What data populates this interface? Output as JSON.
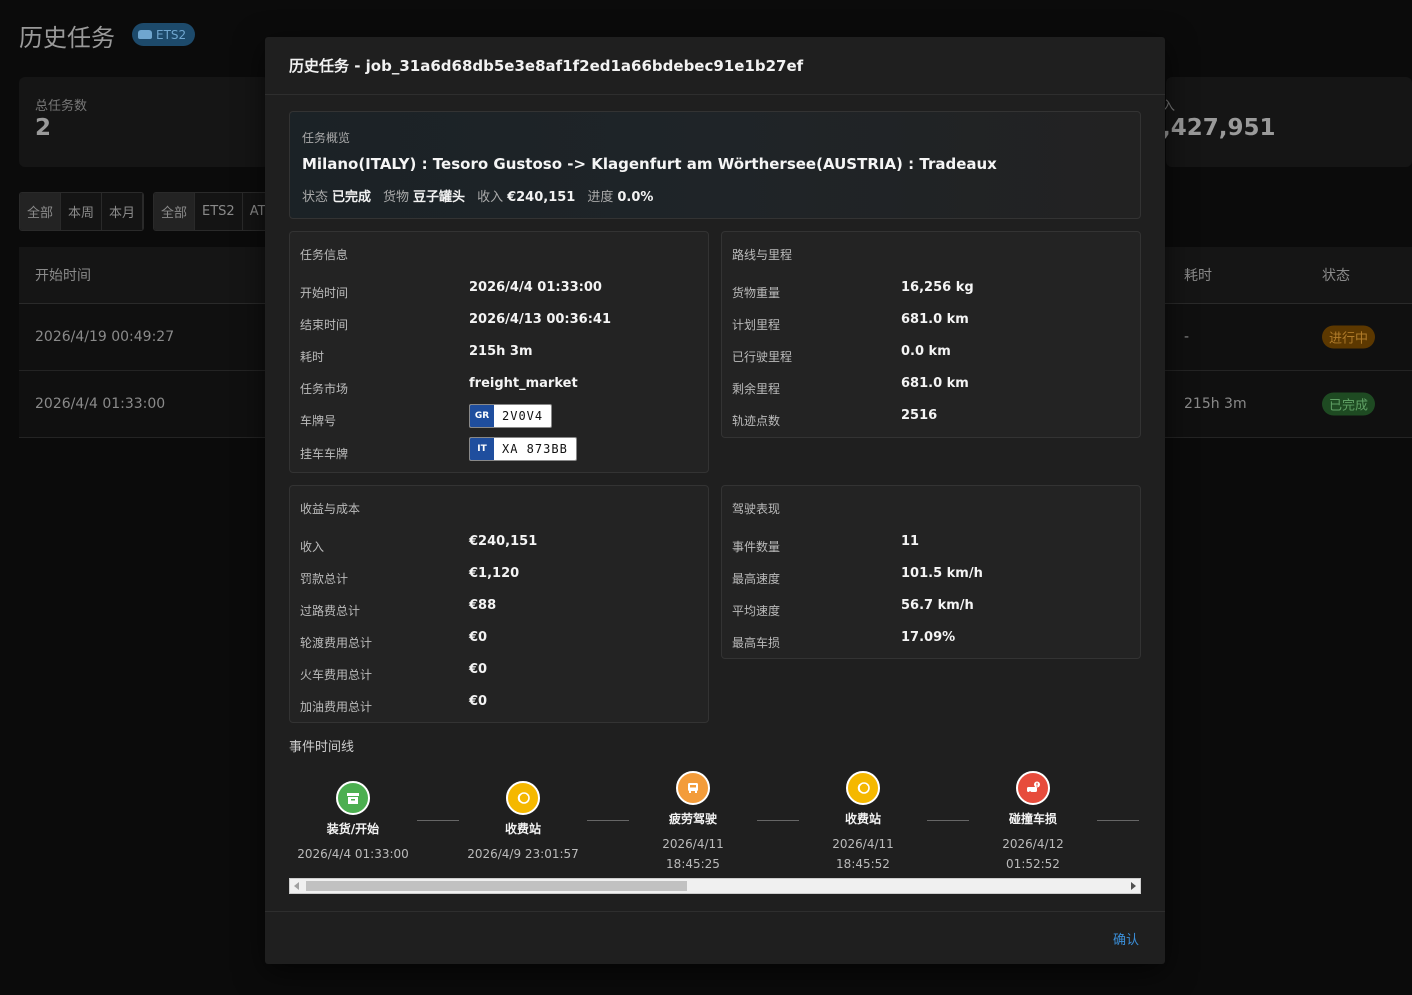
{
  "page": {
    "title": "历史任务",
    "game_badge": "ETS2"
  },
  "stats": {
    "total_jobs_label": "总任务数",
    "total_jobs_value": "2",
    "income_label_partial": "入",
    "income_value_partial": ",427,951"
  },
  "filters": {
    "period": [
      "全部",
      "本周",
      "本月"
    ],
    "game": [
      "全部",
      "ETS2",
      "AT"
    ]
  },
  "table": {
    "headers": {
      "start_time": "开始时间",
      "duration": "耗时",
      "status": "状态"
    },
    "rows": [
      {
        "start_time": "2026/4/19 00:49:27",
        "duration": "-",
        "status": "进行中"
      },
      {
        "start_time": "2026/4/4 01:33:00",
        "duration": "215h 3m",
        "status": "已完成"
      }
    ]
  },
  "modal": {
    "title": "历史任务 - job_31a6d68db5e3e8af1f2ed1a66bdebec91e1b27ef",
    "overview": {
      "caption": "任务概览",
      "route": "Milano(ITALY) : Tesoro Gustoso -> Klagenfurt am Wörthersee(AUSTRIA) : Tradeaux",
      "status_label": "状态",
      "status_value": "已完成",
      "cargo_label": "货物",
      "cargo_value": "豆子罐头",
      "income_label": "收入",
      "income_value": "€240,151",
      "progress_label": "进度",
      "progress_value": "0.0%"
    },
    "job_info": {
      "caption": "任务信息",
      "start_label": "开始时间",
      "start_value": "2026/4/4 01:33:00",
      "end_label": "结束时间",
      "end_value": "2026/4/13 00:36:41",
      "duration_label": "耗时",
      "duration_value": "215h 3m",
      "market_label": "任务市场",
      "market_value": "freight_market",
      "plate_label": "车牌号",
      "plate_country": "GR",
      "plate_value": "2V0V4",
      "trailer_plate_label": "挂车车牌",
      "trailer_country": "IT",
      "trailer_value": "XA 873BB"
    },
    "route_info": {
      "caption": "路线与里程",
      "weight_label": "货物重量",
      "weight_value": "16,256 kg",
      "planned_label": "计划里程",
      "planned_value": "681.0 km",
      "driven_label": "已行驶里程",
      "driven_value": "0.0 km",
      "remaining_label": "剩余里程",
      "remaining_value": "681.0 km",
      "points_label": "轨迹点数",
      "points_value": "2516"
    },
    "finance": {
      "caption": "收益与成本",
      "income_label": "收入",
      "income_value": "€240,151",
      "fines_label": "罚款总计",
      "fines_value": "€1,120",
      "tolls_label": "过路费总计",
      "tolls_value": "€88",
      "ferry_label": "轮渡费用总计",
      "ferry_value": "€0",
      "train_label": "火车费用总计",
      "train_value": "€0",
      "fuel_label": "加油费用总计",
      "fuel_value": "€0"
    },
    "driving": {
      "caption": "驾驶表现",
      "events_label": "事件数量",
      "events_value": "11",
      "max_speed_label": "最高速度",
      "max_speed_value": "101.5 km/h",
      "avg_speed_label": "平均速度",
      "avg_speed_value": "56.7 km/h",
      "max_damage_label": "最高车损",
      "max_damage_value": "17.09%"
    },
    "timeline": {
      "caption": "事件时间线",
      "events": [
        {
          "name": "装货/开始",
          "time": "2026/4/4 01:33:00",
          "icon": "cargo-box-icon",
          "color": "#4caf50"
        },
        {
          "name": "收费站",
          "time": "2026/4/9 23:01:57",
          "icon": "coin-icon",
          "color": "#f5b800"
        },
        {
          "name": "疲劳驾驶",
          "time_line1": "2026/4/11",
          "time_line2": "18:45:25",
          "icon": "bed-icon",
          "color": "#f39c3a"
        },
        {
          "name": "收费站",
          "time_line1": "2026/4/11",
          "time_line2": "18:45:52",
          "icon": "coin-icon",
          "color": "#f5b800"
        },
        {
          "name": "碰撞车损",
          "time_line1": "2026/4/12",
          "time_line2": "01:52:52",
          "icon": "crash-icon",
          "color": "#e74c3c"
        }
      ]
    },
    "confirm_label": "确认"
  }
}
